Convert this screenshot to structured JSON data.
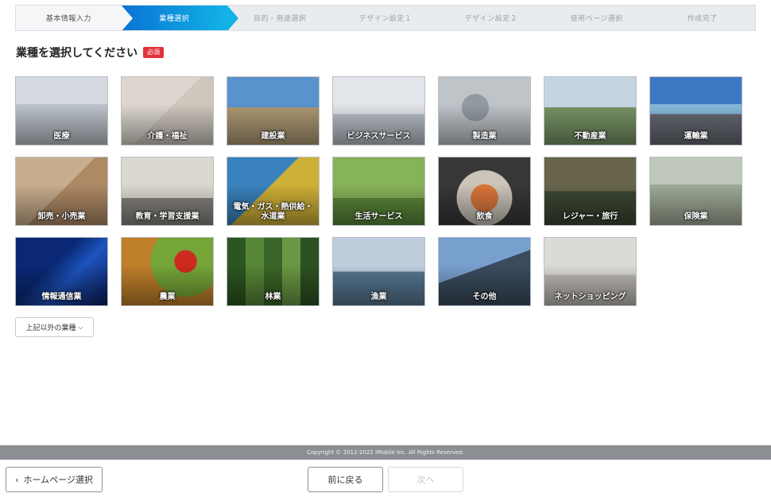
{
  "steps": [
    {
      "label": "基本情報入力",
      "state": "done"
    },
    {
      "label": "業種選択",
      "state": "active"
    },
    {
      "label": "目的・用途選択",
      "state": "pending"
    },
    {
      "label": "デザイン設定１",
      "state": "pending"
    },
    {
      "label": "デザイン設定２",
      "state": "pending"
    },
    {
      "label": "使用ページ選択",
      "state": "pending"
    },
    {
      "label": "作成完了",
      "state": "pending"
    }
  ],
  "heading": {
    "title": "業種を選択してください",
    "required_badge": "必須"
  },
  "industries": [
    {
      "label": "医療"
    },
    {
      "label": "介護・福祉"
    },
    {
      "label": "建設業"
    },
    {
      "label": "ビジネスサービス"
    },
    {
      "label": "製造業"
    },
    {
      "label": "不動産業"
    },
    {
      "label": "運輸業"
    },
    {
      "label": "卸売・小売業"
    },
    {
      "label": "教育・学習支援業"
    },
    {
      "label": "電気・ガス・熱供給・水道業"
    },
    {
      "label": "生活サービス"
    },
    {
      "label": "飲食"
    },
    {
      "label": "レジャー・旅行"
    },
    {
      "label": "保険業"
    },
    {
      "label": "情報通信業"
    },
    {
      "label": "農業"
    },
    {
      "label": "林業"
    },
    {
      "label": "漁業"
    },
    {
      "label": "その他"
    },
    {
      "label": "ネットショッピング"
    }
  ],
  "other_button": {
    "label": "上記以外の業種"
  },
  "footer": {
    "copyright": "Copyright © 2012-2022 iMobile Inc. All Rights Reserved.",
    "home_button": "ホームページ選択",
    "prev_button": "前に戻る",
    "next_button": "次へ"
  },
  "colors": {
    "accent": "#0a73d4",
    "accent_end": "#12b3e6",
    "required": "#e0323a",
    "footer_bg": "#8b8e92"
  }
}
